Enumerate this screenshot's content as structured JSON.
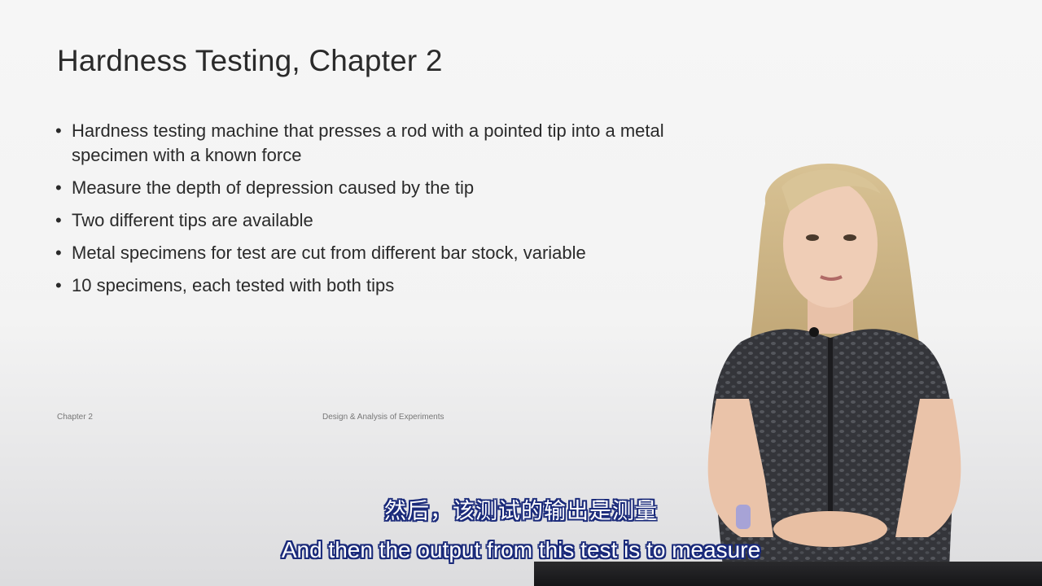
{
  "slide": {
    "title": "Hardness Testing, Chapter 2",
    "bullets": [
      {
        "text": "Hardness testing machine that presses a rod with a pointed tip into a metal specimen with a known force"
      },
      {
        "text": "Measure the depth of depression caused by the tip"
      },
      {
        "text": "Two different tips are available"
      },
      {
        "text": "Metal specimens for test are cut from different bar stock, variable"
      },
      {
        "text": "10 specimens, each tested with both tips"
      }
    ],
    "bullet_glyph": "•",
    "footer_left": "Chapter 2",
    "footer_center": "Design & Analysis of Experiments"
  },
  "subtitles": {
    "chinese": "然后，该测试的输出是测量",
    "english": "And then the output from this test is to measure"
  },
  "colors": {
    "subtitle_fill": "#ffffff",
    "subtitle_outline": "#1a2a7a",
    "dress": "#2f3034",
    "hair": "#cdb486"
  }
}
